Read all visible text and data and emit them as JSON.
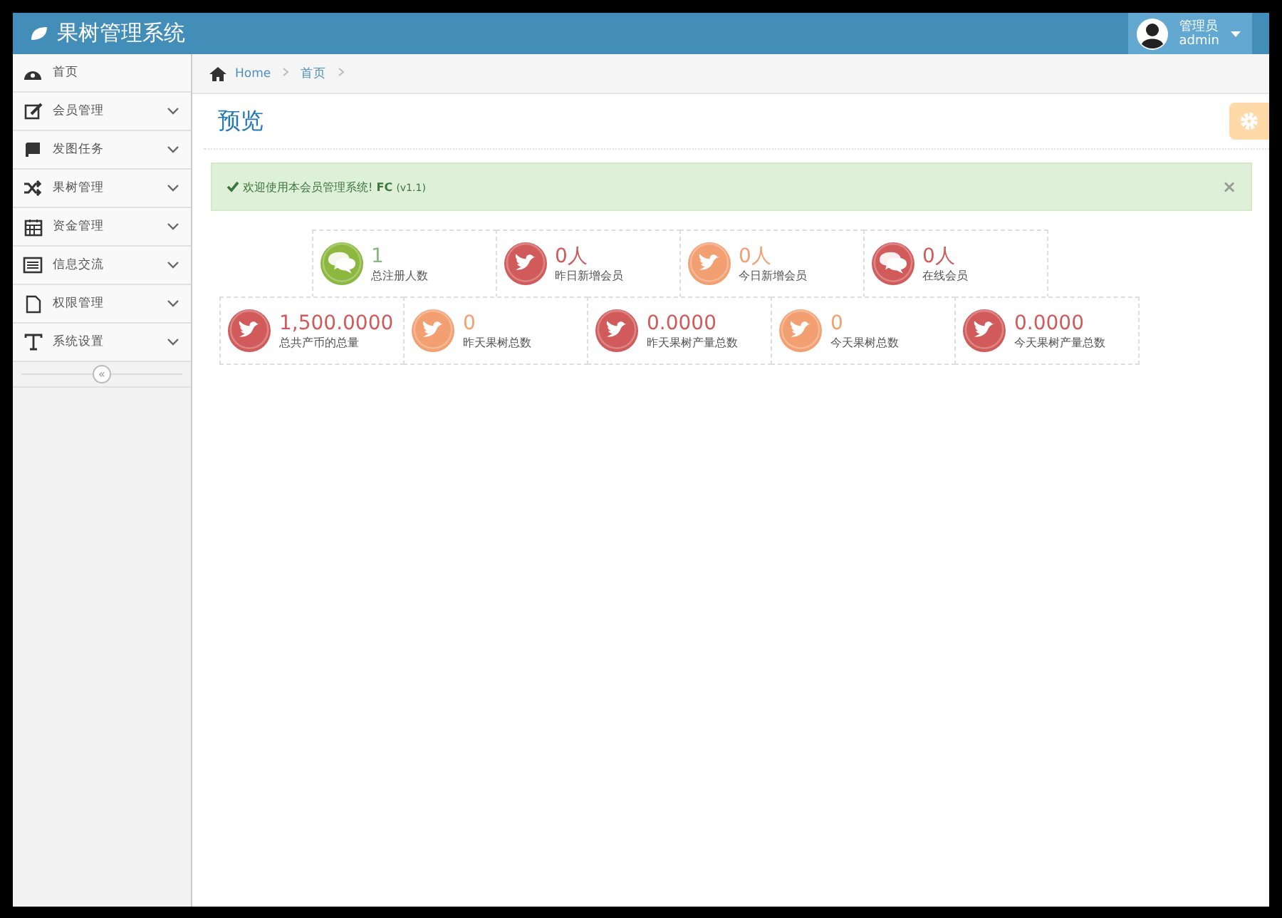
{
  "header": {
    "title": "果树管理系统",
    "user_role": "管理员",
    "user_name": "admin"
  },
  "sidebar": {
    "items": [
      {
        "label": "首页",
        "expandable": false
      },
      {
        "label": "会员管理",
        "expandable": true
      },
      {
        "label": "发图任务",
        "expandable": true
      },
      {
        "label": "果树管理",
        "expandable": true
      },
      {
        "label": "资金管理",
        "expandable": true
      },
      {
        "label": "信息交流",
        "expandable": true
      },
      {
        "label": "权限管理",
        "expandable": true
      },
      {
        "label": "系统设置",
        "expandable": true
      }
    ],
    "collapse": "«"
  },
  "breadcrumb": [
    "Home",
    "首页"
  ],
  "page_title": "预览",
  "alert": {
    "text": "欢迎使用本会员管理系统! **FC** (v1.1)",
    "close": "×"
  },
  "stat_rows": [
    [
      {
        "value": "1",
        "label": "总注册人数",
        "kind": "chat",
        "color": "#8cb83f"
      },
      {
        "value": "0人",
        "label": "昨日新增会员",
        "kind": "bird",
        "color": "#d15b5b"
      },
      {
        "value": "0人",
        "label": "今日新增会员",
        "kind": "bird",
        "color": "#f2a071"
      },
      {
        "value": "0人",
        "label": "在线会员",
        "kind": "chat",
        "color": "#d15b5b"
      }
    ],
    [
      {
        "value": "1,500.0000",
        "label": "总共产币的总量",
        "kind": "bird",
        "color": "#d15b5b"
      },
      {
        "value": "0",
        "label": "昨天果树总数",
        "kind": "bird",
        "color": "#f2a071"
      },
      {
        "value": "0.0000",
        "label": "昨天果树产量总数",
        "kind": "bird",
        "color": "#d15b5b"
      },
      {
        "value": "0",
        "label": "今天果树总数",
        "kind": "bird",
        "color": "#f2a071"
      },
      {
        "value": "0.0000",
        "label": "今天果树产量总数",
        "kind": "bird",
        "color": "#d15b5b"
      }
    ]
  ]
}
